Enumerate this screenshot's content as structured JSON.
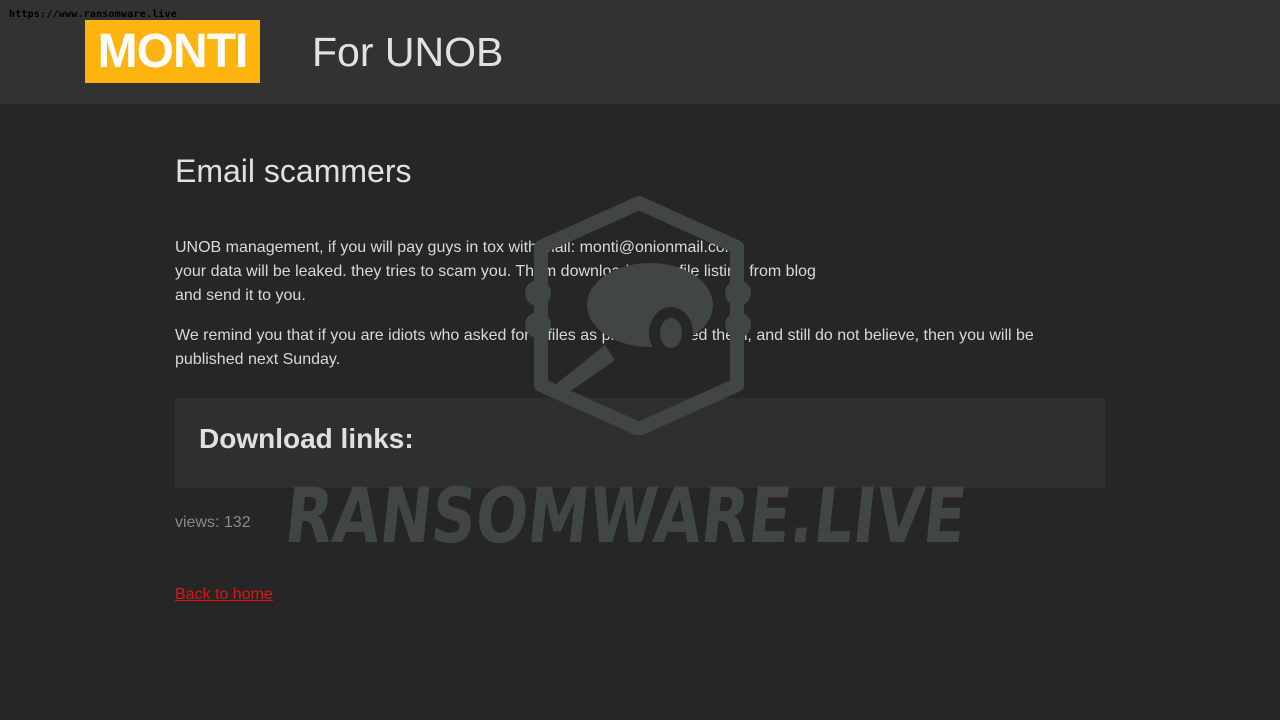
{
  "watermark": {
    "url": "https://www.ransomware.live",
    "brand_text": "RANSOMWARE.LIVE"
  },
  "header": {
    "logo": "MONTI",
    "title": "For UNOB"
  },
  "main": {
    "title": "Email scammers",
    "paragraphs": [
      "UNOB management, if you will pay guys in tox with mail: monti@onionmail.com",
      "your data will be leaked. they tries to scam you. Them downloaded our file listing from blog",
      "and send it to you.",
      "We remind you that if you are idiots who asked for 5 files as proof, received them, and still do not believe, then you will be published next Sunday."
    ],
    "downloads_heading": "Download links:",
    "views": "views: 132",
    "back_link": "Back to home"
  },
  "colors": {
    "background": "#262626",
    "header_bg": "#323232",
    "logo_bg": "#ffb30f",
    "link": "#e01414",
    "watermark": "#3f4644"
  }
}
